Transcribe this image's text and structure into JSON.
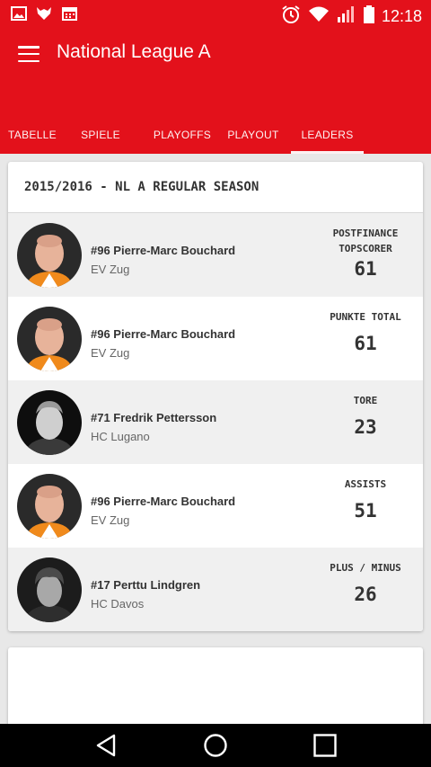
{
  "status_bar": {
    "time": "12:18",
    "icons_left": [
      "image-icon",
      "fox-icon",
      "calendar-icon"
    ],
    "icons_right": [
      "alarm-icon",
      "wifi-icon",
      "signal-icon",
      "battery-icon"
    ]
  },
  "app_bar": {
    "title": "National League A",
    "menu_icon": "hamburger-menu-icon"
  },
  "tabs": [
    {
      "label": "TABELLE",
      "active": false
    },
    {
      "label": "SPIELE",
      "active": false
    },
    {
      "label": "PLAYOFFS",
      "active": false
    },
    {
      "label": "PLAYOUT",
      "active": false
    },
    {
      "label": "LEADERS",
      "active": true
    }
  ],
  "leaders": {
    "season_title": "2015/2016 - NL A REGULAR SEASON",
    "rows": [
      {
        "name": "#96 Pierre-Marc Bouchard",
        "team": "EV Zug",
        "stat_label_1": "POSTFINANCE",
        "stat_label_2": "TOPSCORER",
        "stat_value": "61"
      },
      {
        "name": "#96 Pierre-Marc Bouchard",
        "team": "EV Zug",
        "stat_label_1": "PUNKTE TOTAL",
        "stat_label_2": "",
        "stat_value": "61"
      },
      {
        "name": "#71 Fredrik Pettersson",
        "team": "HC Lugano",
        "stat_label_1": "TORE",
        "stat_label_2": "",
        "stat_value": "23"
      },
      {
        "name": "#96 Pierre-Marc Bouchard",
        "team": "EV Zug",
        "stat_label_1": "ASSISTS",
        "stat_label_2": "",
        "stat_value": "51"
      },
      {
        "name": "#17 Perttu Lindgren",
        "team": "HC Davos",
        "stat_label_1": "PLUS / MINUS",
        "stat_label_2": "",
        "stat_value": "26"
      }
    ]
  },
  "nav_bar": {
    "buttons": [
      "back-icon",
      "home-icon",
      "recents-icon"
    ]
  },
  "colors": {
    "brand_red": "#e3111b",
    "card_bg": "#ffffff",
    "page_bg": "#e8e8e8"
  }
}
